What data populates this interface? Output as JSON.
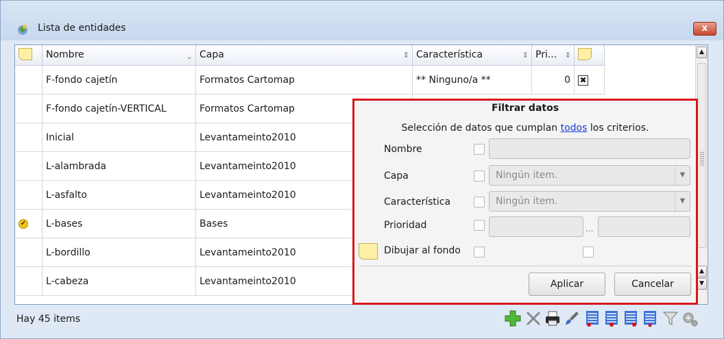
{
  "window": {
    "title": "Lista de entidades",
    "close_label": "x"
  },
  "grid": {
    "columns": [
      "Nombre",
      "Capa",
      "Característica",
      "Pri..."
    ],
    "rows": [
      {
        "nombre": "F-fondo cajetín",
        "capa": "Formatos Cartomap",
        "caracteristica": "** Ninguno/a **",
        "prioridad": "0",
        "checked": false,
        "xmark": true
      },
      {
        "nombre": "F-fondo cajetín-VERTICAL",
        "capa": "Formatos Cartomap",
        "checked": false
      },
      {
        "nombre": "Inicial",
        "capa": "Levantameinto2010",
        "checked": false
      },
      {
        "nombre": "L-alambrada",
        "capa": "Levantameinto2010",
        "checked": false
      },
      {
        "nombre": "L-asfalto",
        "capa": "Levantameinto2010",
        "checked": false
      },
      {
        "nombre": "L-bases",
        "capa": "Bases",
        "checked": true
      },
      {
        "nombre": "L-bordillo",
        "capa": "Levantameinto2010",
        "checked": false
      },
      {
        "nombre": "L-cabeza",
        "capa": "Levantameinto2010",
        "checked": false
      }
    ]
  },
  "filter": {
    "title": "Filtrar datos",
    "subtitle_pre": "Selección de datos que cumplan ",
    "subtitle_link": "todos",
    "subtitle_post": " los criterios.",
    "labels": {
      "nombre": "Nombre",
      "capa": "Capa",
      "caracteristica": "Característica",
      "prioridad": "Prioridad",
      "dibujar": "Dibujar al fondo"
    },
    "capa_value": "Ningún item.",
    "caracteristica_value": "Ningún item.",
    "range_sep": "...",
    "apply_label": "Aplicar",
    "cancel_label": "Cancelar"
  },
  "status": {
    "text": "Hay 45 items"
  },
  "colors": {
    "accent_red": "#d9141b",
    "link": "#1a39d4"
  }
}
